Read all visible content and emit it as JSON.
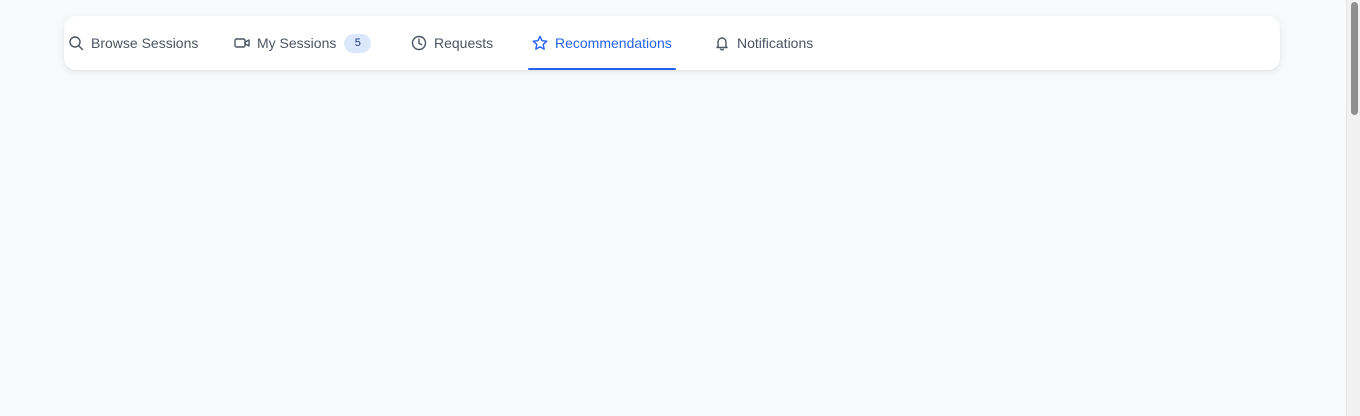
{
  "tabs": [
    {
      "label": "Browse Sessions",
      "icon": "search-icon"
    },
    {
      "label": "My Sessions",
      "icon": "video-camera-icon",
      "badge": "5"
    },
    {
      "label": "Requests",
      "icon": "clock-icon"
    },
    {
      "label": "Recommendations",
      "icon": "star-icon",
      "active": true
    },
    {
      "label": "Notifications",
      "icon": "bell-icon"
    }
  ],
  "colors": {
    "accent": "#2563eb",
    "tab_text": "#4b5563",
    "badge_bg": "#dbe7fb",
    "badge_text": "#1e3a8a",
    "page_bg": "#f8f9fb"
  }
}
